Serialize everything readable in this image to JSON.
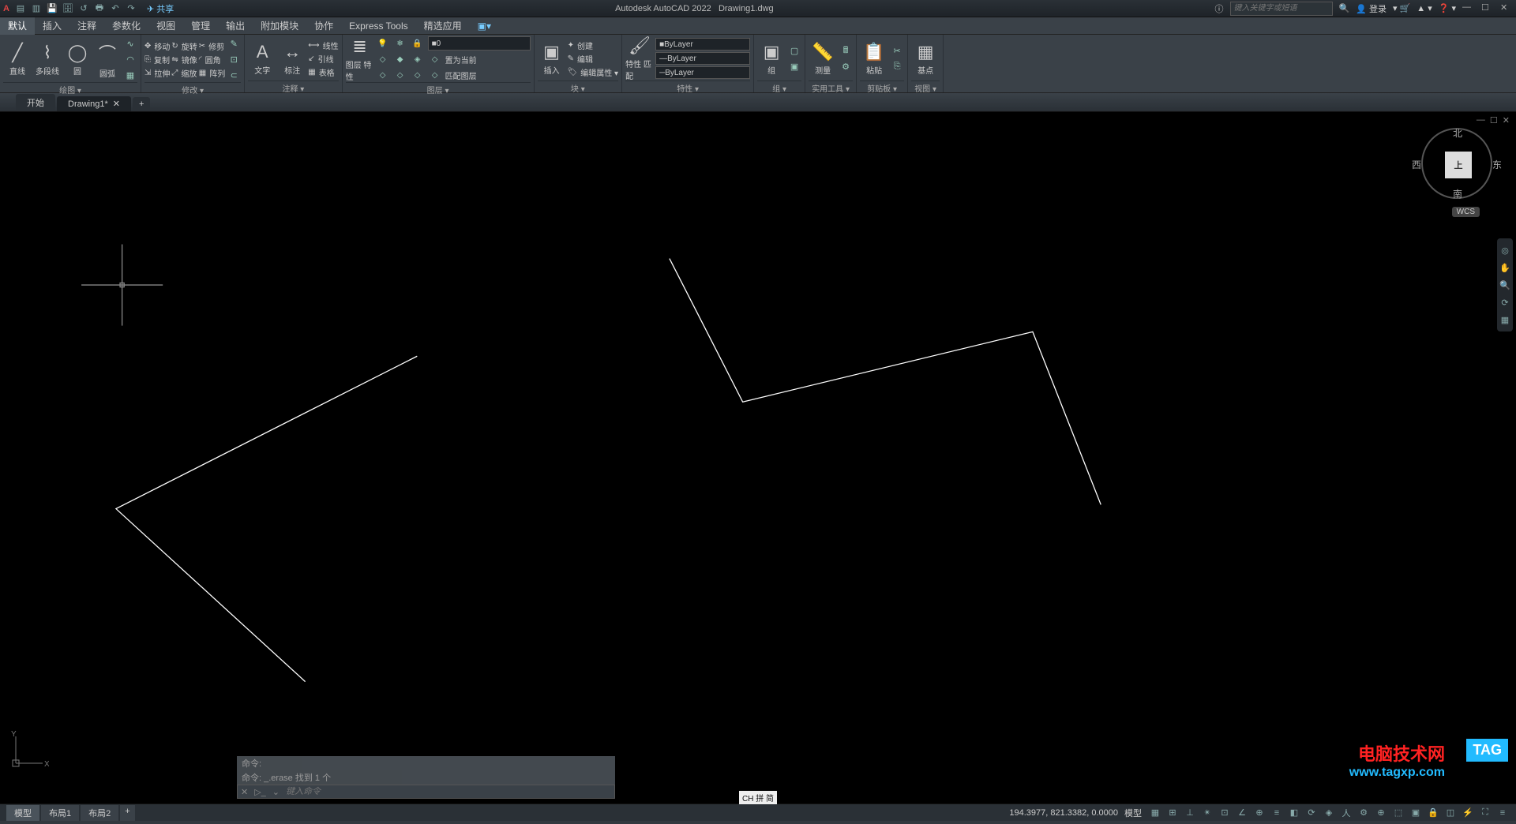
{
  "title": {
    "app": "Autodesk AutoCAD 2022",
    "doc": "Drawing1.dwg"
  },
  "qat_share": "共享",
  "search_placeholder": "键入关键字或短语",
  "login": "登录",
  "menu": [
    "默认",
    "插入",
    "注释",
    "参数化",
    "视图",
    "管理",
    "输出",
    "附加模块",
    "协作",
    "Express Tools",
    "精选应用"
  ],
  "ribbon": {
    "draw": {
      "title": "绘图 ▾",
      "line": "直线",
      "polyline": "多段线",
      "circle": "圆",
      "arc": "圆弧"
    },
    "modify": {
      "title": "修改 ▾",
      "move": "移动",
      "copy": "复制",
      "stretch": "拉伸",
      "rotate": "旋转",
      "mirror": "镜像",
      "scale": "缩放",
      "trim": "修剪",
      "fillet": "圆角",
      "array": "阵列"
    },
    "annotate": {
      "title": "注释 ▾",
      "text": "文字",
      "dim": "标注",
      "linear": "线性",
      "leader": "引线",
      "table": "表格"
    },
    "layer": {
      "title": "图层 ▾",
      "props": "图层\n特性",
      "current": "0",
      "makecurrent": "置为当前",
      "match": "匹配图层"
    },
    "block": {
      "title": "块 ▾",
      "insert": "插入",
      "create": "创建",
      "edit": "编辑",
      "editattrib": "编辑属性 ▾"
    },
    "props": {
      "title": "特性 ▾",
      "match": "特性\n匹配",
      "bylayer1": "ByLayer",
      "bylayer2": "ByLayer",
      "bylayer3": "ByLayer"
    },
    "group": {
      "title": "组 ▾",
      "group": "组"
    },
    "util": {
      "title": "实用工具 ▾",
      "measure": "测量"
    },
    "clip": {
      "title": "剪贴板 ▾",
      "paste": "粘贴"
    },
    "view": {
      "title": "视图 ▾",
      "base": "基点"
    }
  },
  "doctabs": {
    "start": "开始",
    "drawing": "Drawing1*"
  },
  "viewcube": {
    "n": "北",
    "s": "南",
    "e": "东",
    "w": "西",
    "top": "上",
    "wcs": "WCS"
  },
  "cmd": {
    "hist1": "命令:",
    "hist2": "命令: _.erase 找到 1 个",
    "placeholder": "键入命令"
  },
  "ime": "CH 拼 简",
  "status": {
    "model": "模型",
    "layout1": "布局1",
    "layout2": "布局2",
    "coords": "194.3977, 821.3382, 0.0000",
    "modelbtn": "模型"
  },
  "watermark": {
    "cn": "电脑技术网",
    "url": "www.tagxp.com",
    "tag": "TAG"
  }
}
